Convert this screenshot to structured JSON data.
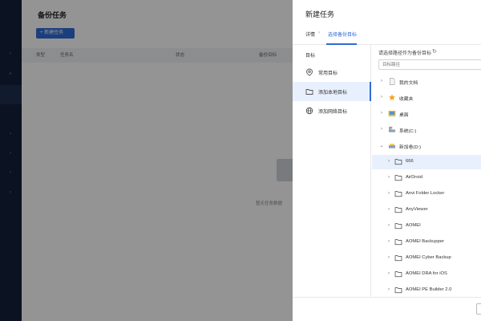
{
  "main": {
    "title": "备份任务",
    "new_task_button": "+ 新建任务",
    "columns": [
      "类型",
      "任务名",
      "状态",
      "备份目标"
    ],
    "empty_text": "暂无任务数据"
  },
  "drawer": {
    "title": "新建任务",
    "tabs": [
      {
        "label": "详情"
      },
      {
        "label": "选择备份目标"
      }
    ],
    "tab_separator": "›",
    "left_header": "目标",
    "targets": [
      {
        "label": "常用目标",
        "icon": "location-pin-icon"
      },
      {
        "label": "添加本地目标",
        "icon": "folder-icon"
      },
      {
        "label": "添加网络目标",
        "icon": "globe-icon"
      }
    ],
    "right_header": "请选择路径作为备份目标",
    "search_placeholder": "目标路径",
    "tree": [
      {
        "label": "我的文档"
      },
      {
        "label": "收藏夹"
      },
      {
        "label": "桌面"
      },
      {
        "label": "系统(C:)"
      },
      {
        "label": "新加卷(D:)"
      },
      {
        "label": "666"
      },
      {
        "label": "AirDroid"
      },
      {
        "label": "Anvi Folder Locker"
      },
      {
        "label": "AnyViewer"
      },
      {
        "label": "AOMEI"
      },
      {
        "label": "AOMEI Backupper"
      },
      {
        "label": "AOMEI Cyber Backup"
      },
      {
        "label": "AOMEI DRA for iOS"
      },
      {
        "label": "AOMEI PE Builder 2.0"
      }
    ]
  },
  "colors": {
    "accent": "#2f6bd6",
    "nav_bg": "#14203a",
    "selected_bg": "#e8f0fe",
    "folder_yellow": "#f4c542",
    "star_orange": "#f5a623"
  }
}
